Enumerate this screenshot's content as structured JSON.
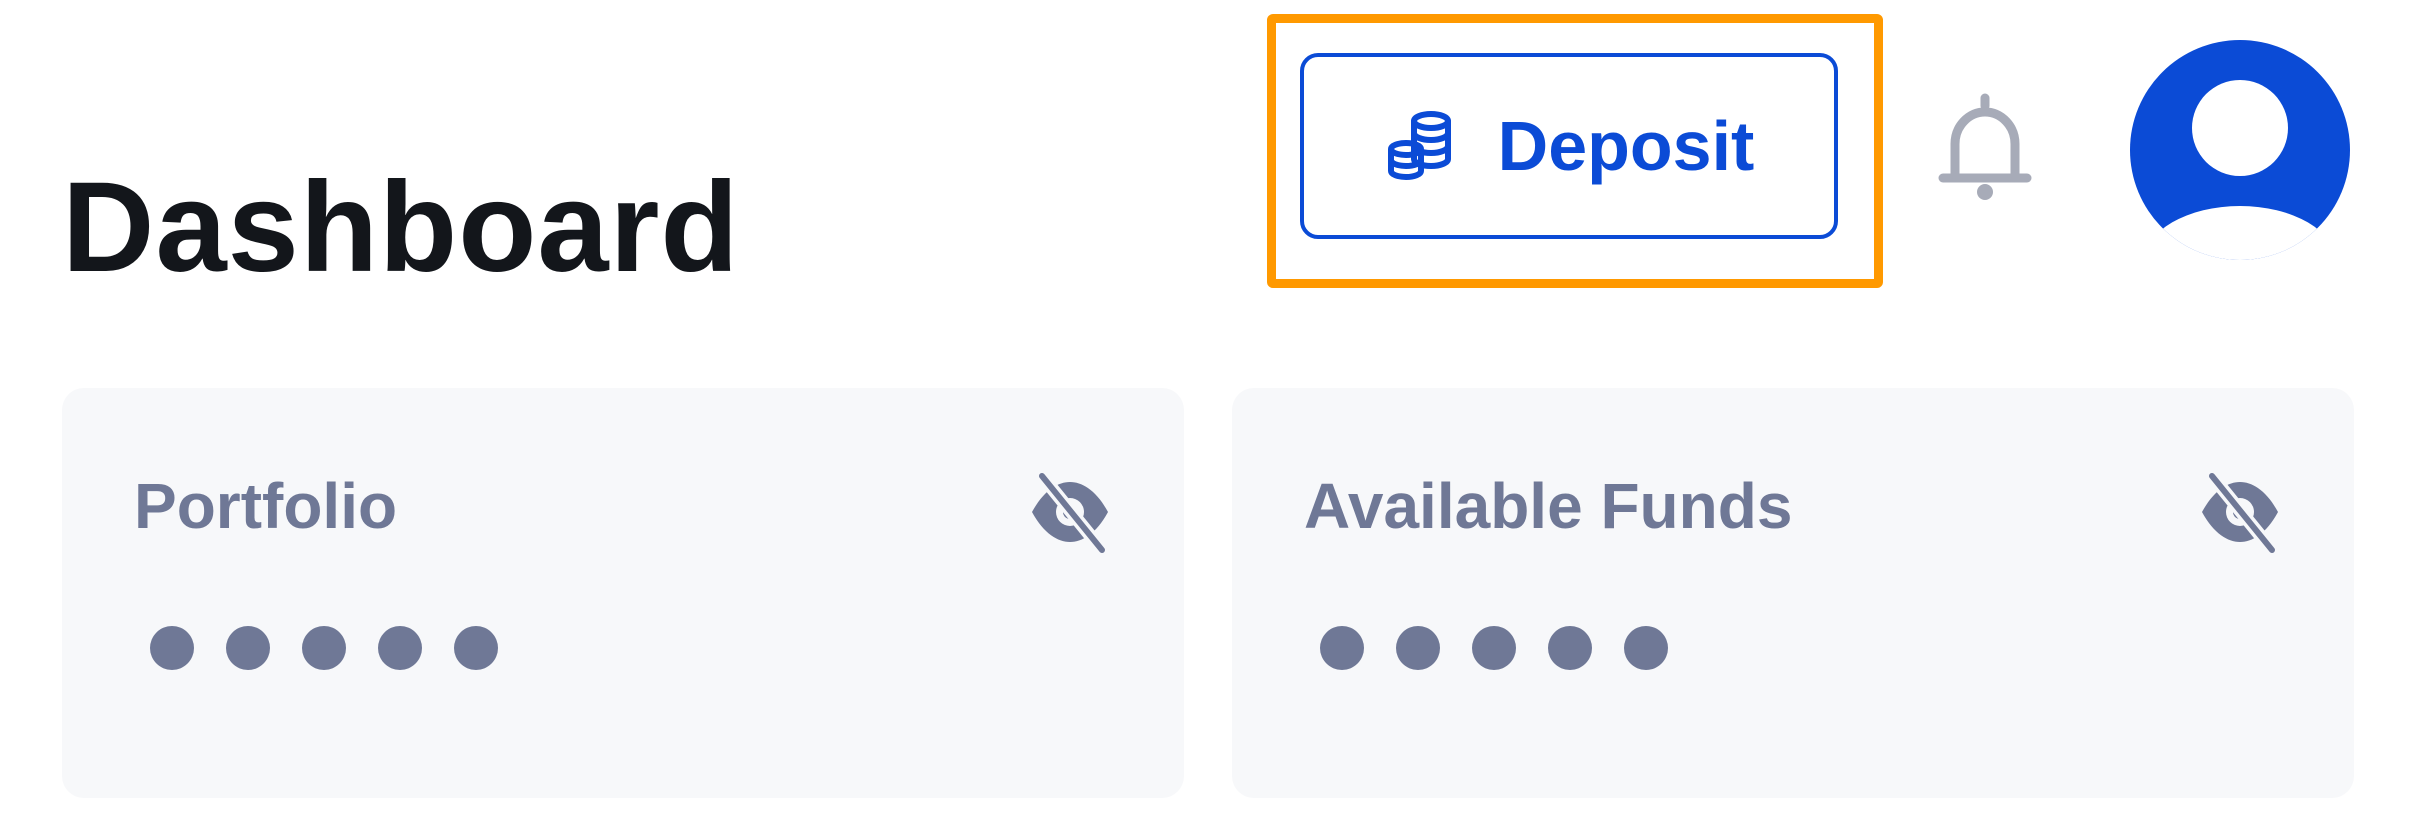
{
  "header": {
    "title": "Dashboard",
    "deposit_label": "Deposit",
    "deposit_icon": "coins-icon",
    "notification_icon": "bell-icon",
    "avatar_icon": "user-avatar-icon"
  },
  "cards": [
    {
      "label": "Portfolio",
      "value_masked": "•••••",
      "visibility_icon": "eye-off-icon"
    },
    {
      "label": "Available Funds",
      "value_masked": "•••••",
      "visibility_icon": "eye-off-icon"
    }
  ],
  "colors": {
    "accent": "#0b4bd6",
    "highlight": "#ff9900",
    "muted_text": "#6f7896",
    "card_background": "#f7f8fa",
    "title_text": "#13161b"
  }
}
